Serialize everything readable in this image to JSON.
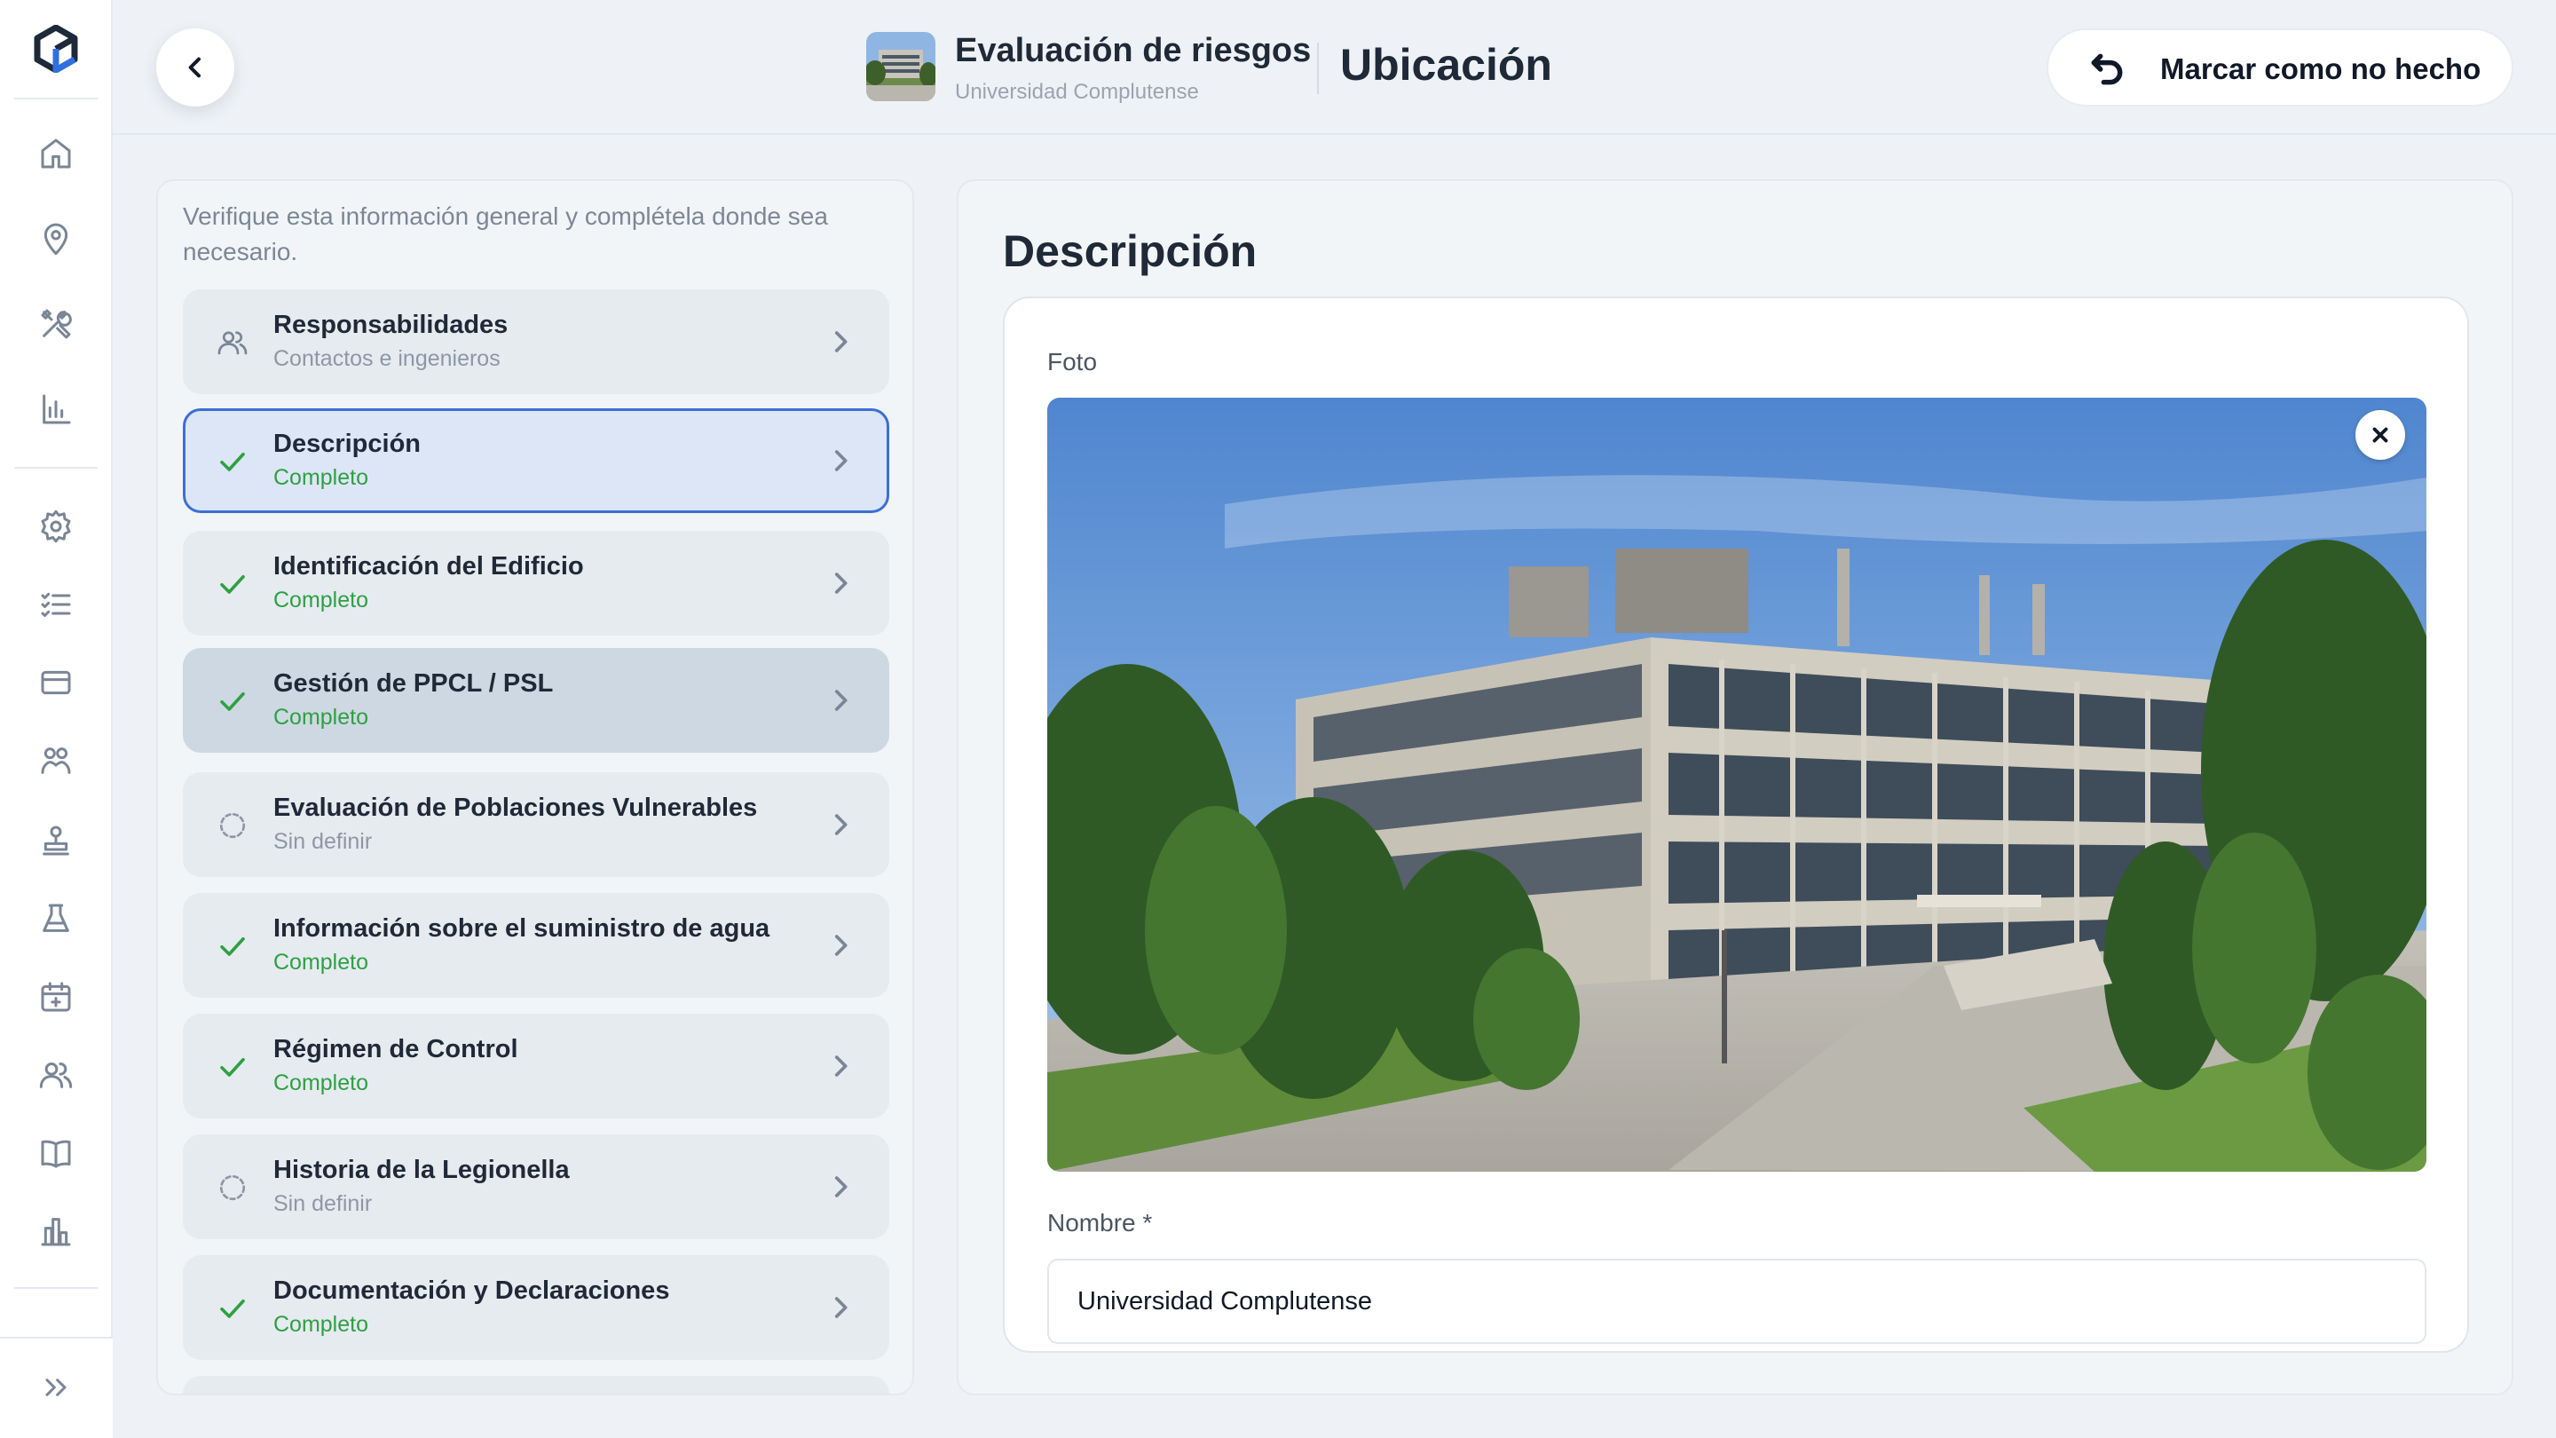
{
  "header": {
    "title": "Evaluación de riesgos",
    "subtitle": "Universidad Complutense",
    "section": "Ubicación",
    "mark_button_label": "Marcar como no hecho"
  },
  "sidebar": {
    "icons": [
      "home-icon",
      "location-pin-icon",
      "tools-icon",
      "bar-chart-icon",
      "gear-icon",
      "checklist-icon",
      "credit-card-icon",
      "group-icon",
      "stamp-icon",
      "flask-icon",
      "calendar-plus-icon",
      "users-icon",
      "book-icon",
      "building-chart-icon",
      "double-chevron-right-icon"
    ]
  },
  "left_panel": {
    "intro": "Verifique esta información general y complétela donde sea necesario.",
    "steps": [
      {
        "title": "Responsabilidades",
        "status": "Contactos e ingenieros",
        "state": "info"
      },
      {
        "title": "Descripción",
        "status": "Completo",
        "state": "done"
      },
      {
        "title": "Identificación del Edificio",
        "status": "Completo",
        "state": "done"
      },
      {
        "title": "Gestión de PPCL / PSL",
        "status": "Completo",
        "state": "done"
      },
      {
        "title": "Evaluación de Poblaciones Vulnerables",
        "status": "Sin definir",
        "state": "pending"
      },
      {
        "title": "Información sobre el suministro de agua",
        "status": "Completo",
        "state": "done"
      },
      {
        "title": "Régimen de Control",
        "status": "Completo",
        "state": "done"
      },
      {
        "title": "Historia de la Legionella",
        "status": "Sin definir",
        "state": "pending"
      },
      {
        "title": "Documentación y Declaraciones",
        "status": "Completo",
        "state": "done"
      }
    ]
  },
  "main": {
    "section_title": "Descripción",
    "photo_label": "Foto",
    "name_label": "Nombre *",
    "name_value": "Universidad Complutense"
  },
  "colors": {
    "accent": "#3b6fd4",
    "success": "#2ea043",
    "muted": "#8d97a5"
  }
}
